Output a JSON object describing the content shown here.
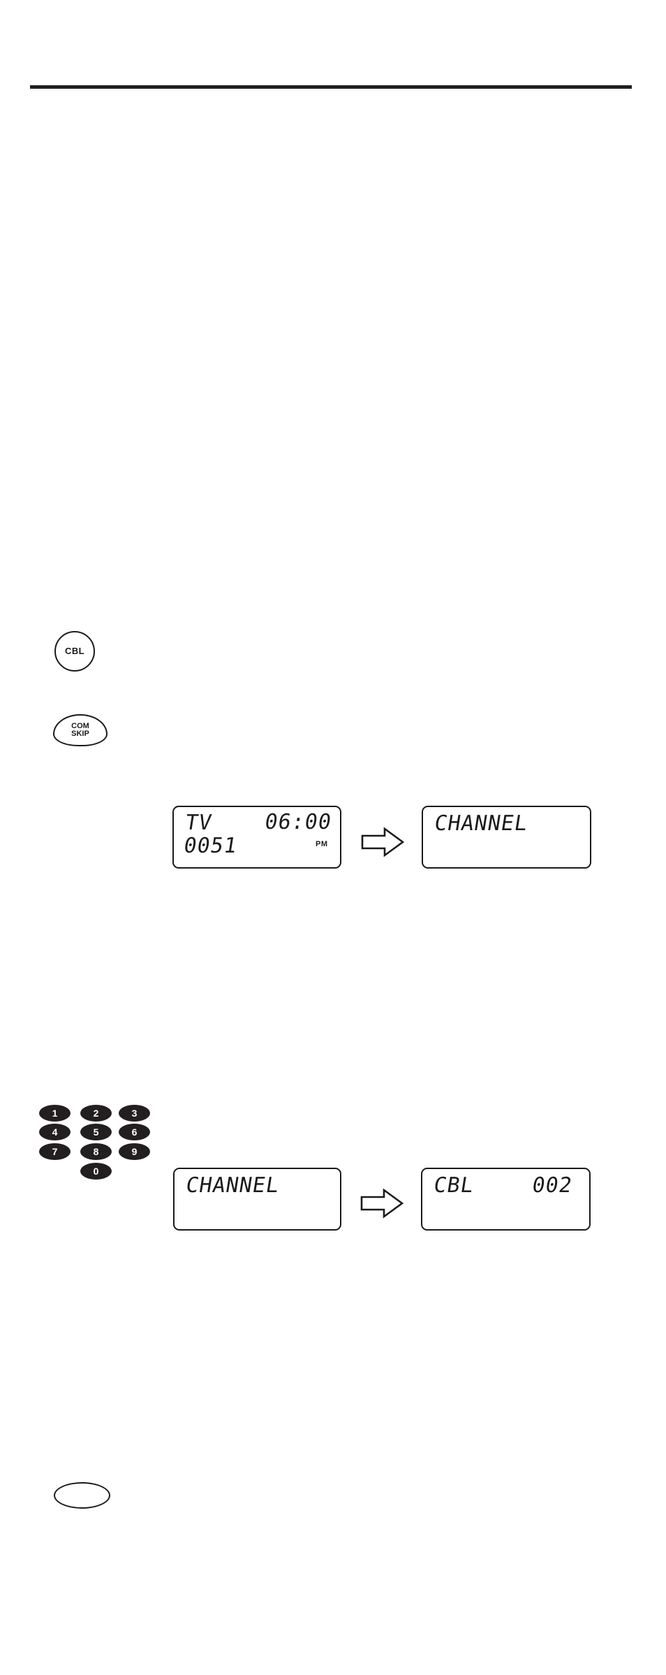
{
  "page": {
    "background_color": "#ffffff",
    "rule_color": "#231f20",
    "ink_color": "#1a1a1a"
  },
  "buttons": {
    "cbl": {
      "label": "CBL",
      "shape": "circle"
    },
    "com_skip": {
      "line1": "COM",
      "line2": "SKIP",
      "shape": "oval"
    },
    "blank_oval": {
      "label": "",
      "shape": "oval"
    }
  },
  "keypad": {
    "keys": [
      {
        "label": "1",
        "col": 0,
        "row": 0
      },
      {
        "label": "2",
        "col": 1,
        "row": 0
      },
      {
        "label": "3",
        "col": 2,
        "row": 0
      },
      {
        "label": "4",
        "col": 0,
        "row": 1
      },
      {
        "label": "5",
        "col": 1,
        "row": 1
      },
      {
        "label": "6",
        "col": 2,
        "row": 1
      },
      {
        "label": "7",
        "col": 0,
        "row": 2
      },
      {
        "label": "8",
        "col": 1,
        "row": 2
      },
      {
        "label": "9",
        "col": 2,
        "row": 2
      },
      {
        "label": "0",
        "col": 1,
        "row": 3
      }
    ]
  },
  "displays": {
    "step1_before": {
      "mode": "TV",
      "channel": "0051",
      "time": "06:00",
      "ampm": "PM"
    },
    "step1_after": {
      "text": "CHANNEL"
    },
    "step2_before": {
      "text": "CHANNEL"
    },
    "step2_after": {
      "mode": "CBL",
      "channel": "002"
    }
  },
  "arrows": {
    "arrow1": {
      "icon": "block-arrow-right-icon",
      "direction": "right"
    },
    "arrow2": {
      "icon": "block-arrow-right-icon",
      "direction": "right"
    }
  }
}
